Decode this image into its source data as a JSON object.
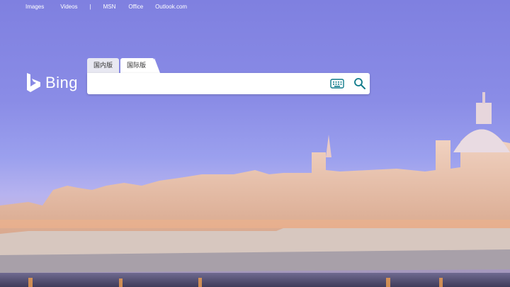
{
  "nav": {
    "items": [
      "Images",
      "Videos",
      "|",
      "MSN",
      "Office",
      "Outlook.com"
    ]
  },
  "logo": {
    "text": "Bing"
  },
  "search": {
    "tabs": [
      "国内版",
      "国际版"
    ],
    "active_tab": "国际版",
    "value": "",
    "placeholder": ""
  },
  "icons": {
    "keyboard": "keyboard-icon",
    "search": "search-icon",
    "logo": "bing-logo-icon"
  },
  "colors": {
    "sky": "#8a8ce6",
    "search_icon": "#0e7a8a",
    "text": "#ffffff"
  }
}
